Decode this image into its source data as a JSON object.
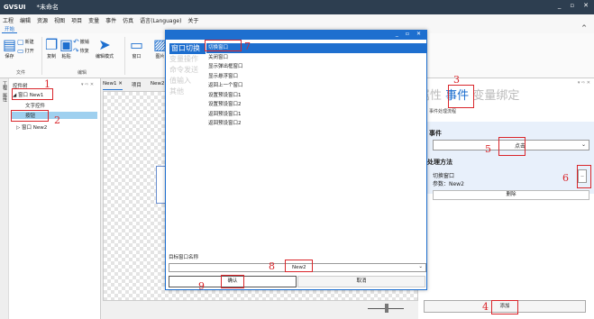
{
  "titlebar": {
    "app": "GVSUI",
    "doc": "*未命名",
    "controls": [
      "_",
      "▫",
      "✕"
    ]
  },
  "menu": [
    "工程",
    "编辑",
    "资源",
    "视图",
    "项目",
    "变量",
    "事件",
    "仿真",
    "语言(Language)",
    "关于"
  ],
  "ribbon": {
    "tab": "开始",
    "collapse": "^",
    "buttons": {
      "save": "保存",
      "new": "新建",
      "open": "打开",
      "copy": "复制",
      "paste": "粘贴",
      "undo": "撤销",
      "redo": "恢复",
      "select_mode": "编辑模式",
      "window": "窗口",
      "image": "图片"
    },
    "groups": {
      "file": "文件",
      "edit": "编辑"
    }
  },
  "left_panel": {
    "strip": [
      "工程",
      "属性"
    ],
    "title": "控件树",
    "pin": "▾ ⇨ ✕",
    "tree": [
      "◢ 窗口 New1",
      "文字控件",
      "按钮",
      "▷ 窗口 New2"
    ]
  },
  "doc_tabs": [
    "New1 ✕",
    "项目",
    "New2"
  ],
  "right_panel": {
    "tabs": {
      "prop": "属性",
      "event": "事件",
      "binding": "变量绑定"
    },
    "pin": "▾ ⇨ ✕",
    "subtitle": "事件处理流程",
    "event_label": "事件",
    "event_value": "点击",
    "handler_label": "处理方法",
    "handler_line1": "切换窗口",
    "handler_line2": "参数：New2",
    "more": "..",
    "delete": "删除",
    "add": "添加"
  },
  "dialog": {
    "controls": [
      "_",
      "▫",
      "✕"
    ],
    "categories": [
      "窗口切换",
      "变量操作",
      "命令发送",
      "值输入",
      "其他"
    ],
    "actions": [
      "切换窗口",
      "关闭窗口",
      "显示弹出框窗口",
      "显示悬浮窗口",
      "返回上一个窗口",
      "设置预设窗口1",
      "设置预设窗口2",
      "返回预设窗口1",
      "返回预设窗口2"
    ],
    "target_label": "目标窗口名称",
    "target_value": "New2",
    "ok": "确认",
    "cancel": "取消"
  },
  "annotations": [
    "1",
    "2",
    "3",
    "4",
    "5",
    "6",
    "7",
    "8",
    "9"
  ],
  "colors": {
    "accent": "#1e6fcf",
    "titlebar": "#2d3e50",
    "selection": "#9fd0ef",
    "annotation": "#d9252a"
  }
}
